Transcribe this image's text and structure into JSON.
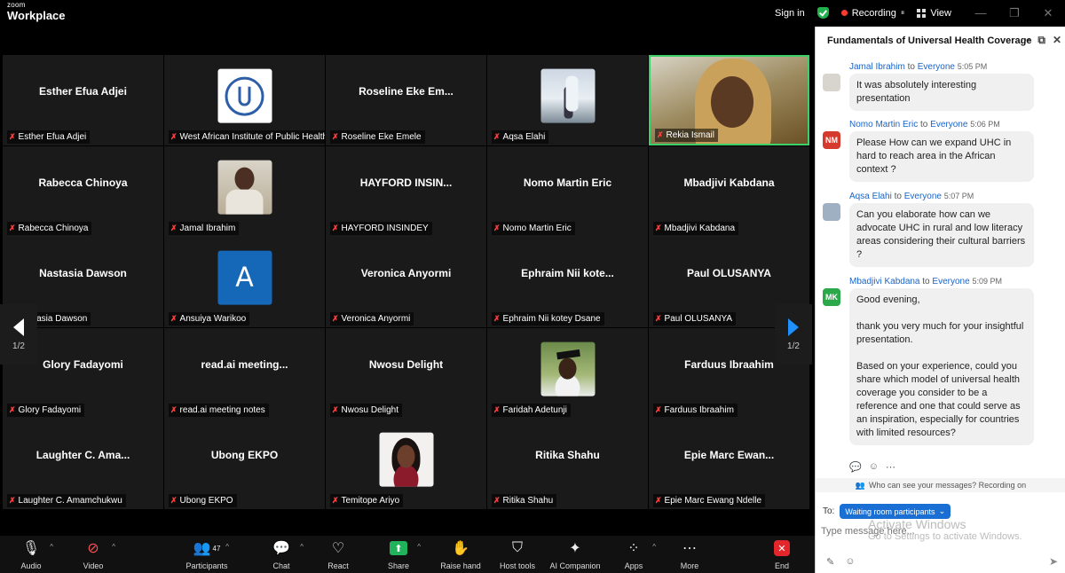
{
  "window": {
    "logo_top": "zoom",
    "logo_bottom": "Workplace",
    "sign_in": "Sign in",
    "recording": "Recording",
    "view": "View"
  },
  "gallery": {
    "page_indicator_left": "1/2",
    "page_indicator_right": "1/2",
    "tiles": [
      {
        "display": "Esther Efua Adjei",
        "label": "Esther Efua Adjei"
      },
      {
        "display": "",
        "label": "West African Institute of Public Health"
      },
      {
        "display": "Roseline Eke Em...",
        "label": "Roseline Eke Emele"
      },
      {
        "display": "",
        "label": "Aqsa Elahi"
      },
      {
        "display": "",
        "label": "Rekia Ismail"
      },
      {
        "display": "Rabecca Chinoya",
        "label": "Rabecca Chinoya"
      },
      {
        "display": "",
        "label": "Jamal Ibrahim"
      },
      {
        "display": "HAYFORD INSIN...",
        "label": "HAYFORD INSINDEY"
      },
      {
        "display": "Nomo Martin Eric",
        "label": "Nomo Martin Eric"
      },
      {
        "display": "Mbadjivi Kabdana",
        "label": "Mbadjivi Kabdana"
      },
      {
        "display": "Nastasia Dawson",
        "label": "Nastasia Dawson"
      },
      {
        "display": "",
        "label": "Ansuiya Warikoo",
        "avatar_letter": "A"
      },
      {
        "display": "Veronica Anyormi",
        "label": "Veronica Anyormi"
      },
      {
        "display": "Ephraim Nii kote...",
        "label": "Ephraim Nii kotey Dsane"
      },
      {
        "display": "Paul OLUSANYA",
        "label": "Paul OLUSANYA"
      },
      {
        "display": "Glory Fadayomi",
        "label": "Glory Fadayomi"
      },
      {
        "display": "read.ai meeting...",
        "label": "read.ai meeting notes"
      },
      {
        "display": "Nwosu Delight",
        "label": "Nwosu Delight"
      },
      {
        "display": "",
        "label": "Faridah Adetunji"
      },
      {
        "display": "Farduus Ibraahim",
        "label": "Farduus Ibraahim"
      },
      {
        "display": "Laughter C. Ama...",
        "label": "Laughter C. Amamchukwu"
      },
      {
        "display": "Ubong EKPO",
        "label": "Ubong EKPO"
      },
      {
        "display": "",
        "label": "Temitope Ariyo"
      },
      {
        "display": "Ritika Shahu",
        "label": "Ritika Shahu"
      },
      {
        "display": "Epie Marc Ewan...",
        "label": "Epie Marc Ewang Ndelle"
      }
    ]
  },
  "chat": {
    "title": "Fundamentals of Universal Health Coverage",
    "messages": [
      {
        "sender": "Jamal Ibrahim",
        "to_word": "to",
        "recipient": "Everyone",
        "time": "5:05 PM",
        "avatar": "",
        "avatar_color": "#d8d4ce",
        "lines": [
          "It was absolutely interesting presentation"
        ]
      },
      {
        "sender": "Nomo Martin Eric",
        "to_word": "to",
        "recipient": "Everyone",
        "time": "5:06 PM",
        "avatar": "NM",
        "avatar_color": "#d63a2f",
        "lines": [
          "Please How can we expand UHC in hard to reach area in the African context ?"
        ]
      },
      {
        "sender": "Aqsa Elahi",
        "to_word": "to",
        "recipient": "Everyone",
        "time": "5:07 PM",
        "avatar": "",
        "avatar_color": "#9fb0c2",
        "lines": [
          "Can you elaborate how can we advocate UHC in rural and low literacy areas considering their cultural barriers ?"
        ]
      },
      {
        "sender": "Mbadjivi Kabdana",
        "to_word": "to",
        "recipient": "Everyone",
        "time": "5:09 PM",
        "avatar": "MK",
        "avatar_color": "#2aa84a",
        "lines": [
          "Good evening,",
          "thank you very much for your insightful presentation.",
          "Based on your experience, could you share which model of universal health coverage you consider to be a reference and one that could serve as an inspiration, especially for countries with limited resources?"
        ]
      }
    ],
    "privacy_text": "Who can see your messages? Recording on",
    "to_label": "To:",
    "to_value": "Waiting room participants",
    "input_placeholder": "Type message here...",
    "watermark_title": "Activate Windows",
    "watermark_sub": "Go to Settings to activate Windows."
  },
  "toolbar": {
    "audio": "Audio",
    "video": "Video",
    "participants": "Participants",
    "participants_count": "47",
    "chat": "Chat",
    "react": "React",
    "share": "Share",
    "raise_hand": "Raise hand",
    "host_tools": "Host tools",
    "ai_companion": "AI Companion",
    "apps": "Apps",
    "more": "More",
    "end": "End"
  },
  "colors": {
    "active_speaker": "#3ccf6a",
    "chat_sender": "#1a64c8",
    "share_green": "#21b35b",
    "end_red": "#e3262c"
  }
}
